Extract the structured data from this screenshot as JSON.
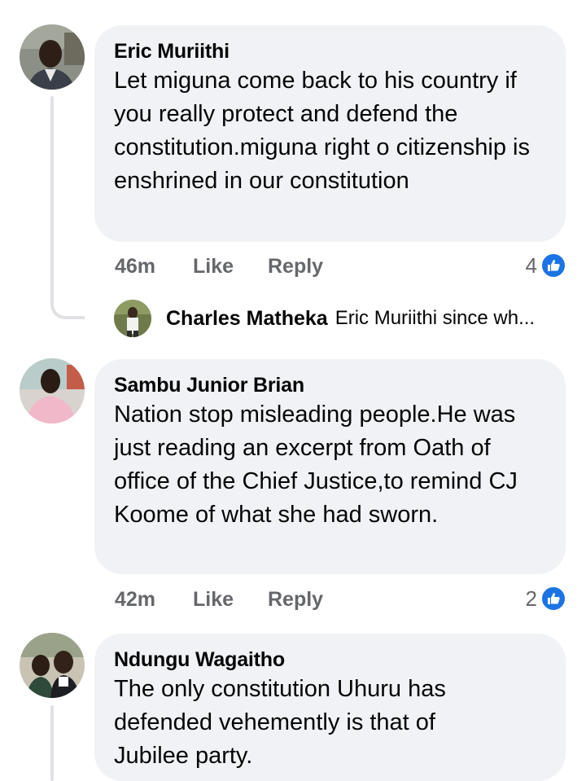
{
  "colors": {
    "bubble": "#f0f2f5",
    "meta_text": "#65676b",
    "like_blue": "#1b74e4",
    "thread_line": "#dfe1e5"
  },
  "comments": [
    {
      "author": "Eric Muriithi",
      "text": "Let miguna come back to his country if you really protect and defend the constitution.miguna right o citizenship is enshrined in our constitution",
      "time": "46m",
      "like_label": "Like",
      "reply_label": "Reply",
      "reaction_count": "4",
      "reaction_icon": "thumbs-up-icon"
    },
    {
      "author": "Sambu Junior Brian",
      "text": "Nation stop misleading people.He was just reading an excerpt from Oath of office of the Chief Justice,to remind CJ Koome of what she had sworn.",
      "time": "42m",
      "like_label": "Like",
      "reply_label": "Reply",
      "reaction_count": "2",
      "reaction_icon": "thumbs-up-icon"
    },
    {
      "author": "Ndungu Wagaitho",
      "text": "The only constitution Uhuru has defended vehemently is that of Jubilee party."
    }
  ],
  "reply_preview": {
    "author": "Charles Matheka",
    "text": "Eric Muriithi since wh..."
  }
}
